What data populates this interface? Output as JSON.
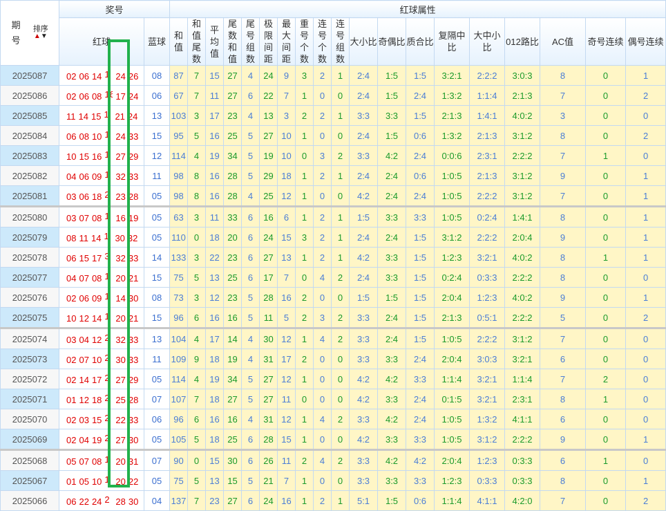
{
  "header": {
    "period": "期号",
    "sort": "排序",
    "sort_up": "▲",
    "sort_down": "▼",
    "prize": "奖号",
    "red_attrs": "红球属性",
    "red_ball": "红球",
    "blue_ball": "蓝球",
    "attr_columns": [
      "和值",
      "和值尾数",
      "平均值",
      "尾数和值",
      "尾号组数",
      "极限间距",
      "最大间距",
      "重号个数",
      "连号个数",
      "连号组数",
      "大小比",
      "奇偶比",
      "质合比",
      "复隔中比",
      "大中小比",
      "012路比",
      "AC值",
      "奇号连续",
      "偶号连续"
    ]
  },
  "colors": {
    "red": "#e00000",
    "blue": "#3b6fd0",
    "green": "#1a9a2a",
    "highlight_box": "#22b14c",
    "attr_bg": "#fff6c6"
  },
  "rows": [
    {
      "period": "2025087",
      "red": [
        "02",
        "06",
        "14",
        "1",
        "24",
        "26"
      ],
      "blue": "08",
      "attrs": [
        "87",
        "7",
        "15",
        "27",
        "4",
        "24",
        "9",
        "3",
        "2",
        "1",
        "2:4",
        "1:5",
        "1:5",
        "3:2:1",
        "2:2:2",
        "3:0:3",
        "8",
        "0",
        "1"
      ]
    },
    {
      "period": "2025086",
      "red": [
        "02",
        "06",
        "08",
        "16",
        "17",
        "24"
      ],
      "blue": "06",
      "attrs": [
        "67",
        "7",
        "11",
        "27",
        "6",
        "22",
        "7",
        "1",
        "0",
        "0",
        "2:4",
        "1:5",
        "2:4",
        "1:3:2",
        "1:1:4",
        "2:1:3",
        "7",
        "0",
        "2"
      ]
    },
    {
      "period": "2025085",
      "red": [
        "11",
        "14",
        "15",
        "1",
        "21",
        "24"
      ],
      "blue": "13",
      "attrs": [
        "103",
        "3",
        "17",
        "23",
        "4",
        "13",
        "3",
        "2",
        "2",
        "1",
        "3:3",
        "3:3",
        "1:5",
        "2:1:3",
        "1:4:1",
        "4:0:2",
        "3",
        "0",
        "0"
      ]
    },
    {
      "period": "2025084",
      "red": [
        "06",
        "08",
        "10",
        "1",
        "24",
        "33"
      ],
      "blue": "15",
      "attrs": [
        "95",
        "5",
        "16",
        "25",
        "5",
        "27",
        "10",
        "1",
        "0",
        "0",
        "2:4",
        "1:5",
        "0:6",
        "1:3:2",
        "2:1:3",
        "3:1:2",
        "8",
        "0",
        "2"
      ]
    },
    {
      "period": "2025083",
      "red": [
        "10",
        "15",
        "16",
        "1",
        "27",
        "29"
      ],
      "blue": "12",
      "attrs": [
        "114",
        "4",
        "19",
        "34",
        "5",
        "19",
        "10",
        "0",
        "3",
        "2",
        "3:3",
        "4:2",
        "2:4",
        "0:0:6",
        "2:3:1",
        "2:2:2",
        "7",
        "1",
        "0"
      ]
    },
    {
      "period": "2025082",
      "red": [
        "04",
        "06",
        "09",
        "1",
        "32",
        "33"
      ],
      "blue": "11",
      "attrs": [
        "98",
        "8",
        "16",
        "28",
        "5",
        "29",
        "18",
        "1",
        "2",
        "1",
        "2:4",
        "2:4",
        "0:6",
        "1:0:5",
        "2:1:3",
        "3:1:2",
        "9",
        "0",
        "1"
      ]
    },
    {
      "period": "2025081",
      "red": [
        "03",
        "06",
        "18",
        "2",
        "23",
        "28"
      ],
      "blue": "05",
      "attrs": [
        "98",
        "8",
        "16",
        "28",
        "4",
        "25",
        "12",
        "1",
        "0",
        "0",
        "4:2",
        "2:4",
        "2:4",
        "1:0:5",
        "2:2:2",
        "3:1:2",
        "7",
        "0",
        "1"
      ]
    },
    {
      "period": "2025080",
      "red": [
        "03",
        "07",
        "08",
        "1",
        "16",
        "19"
      ],
      "blue": "05",
      "attrs": [
        "63",
        "3",
        "11",
        "33",
        "6",
        "16",
        "6",
        "1",
        "2",
        "1",
        "1:5",
        "3:3",
        "3:3",
        "1:0:5",
        "0:2:4",
        "1:4:1",
        "8",
        "0",
        "1"
      ]
    },
    {
      "period": "2025079",
      "red": [
        "08",
        "11",
        "14",
        "1",
        "30",
        "32"
      ],
      "blue": "05",
      "attrs": [
        "110",
        "0",
        "18",
        "20",
        "6",
        "24",
        "15",
        "3",
        "2",
        "1",
        "2:4",
        "2:4",
        "1:5",
        "3:1:2",
        "2:2:2",
        "2:0:4",
        "9",
        "0",
        "1"
      ]
    },
    {
      "period": "2025078",
      "red": [
        "06",
        "15",
        "17",
        "3",
        "32",
        "33"
      ],
      "blue": "14",
      "attrs": [
        "133",
        "3",
        "22",
        "23",
        "6",
        "27",
        "13",
        "1",
        "2",
        "1",
        "4:2",
        "3:3",
        "1:5",
        "1:2:3",
        "3:2:1",
        "4:0:2",
        "8",
        "1",
        "1"
      ]
    },
    {
      "period": "2025077",
      "red": [
        "04",
        "07",
        "08",
        "1",
        "20",
        "21"
      ],
      "blue": "15",
      "attrs": [
        "75",
        "5",
        "13",
        "25",
        "6",
        "17",
        "7",
        "0",
        "4",
        "2",
        "2:4",
        "3:3",
        "1:5",
        "0:2:4",
        "0:3:3",
        "2:2:2",
        "8",
        "0",
        "0"
      ]
    },
    {
      "period": "2025076",
      "red": [
        "02",
        "06",
        "09",
        "1",
        "14",
        "30"
      ],
      "blue": "08",
      "attrs": [
        "73",
        "3",
        "12",
        "23",
        "5",
        "28",
        "16",
        "2",
        "0",
        "0",
        "1:5",
        "1:5",
        "1:5",
        "2:0:4",
        "1:2:3",
        "4:0:2",
        "9",
        "0",
        "1"
      ]
    },
    {
      "period": "2025075",
      "red": [
        "10",
        "12",
        "14",
        "1",
        "20",
        "21"
      ],
      "blue": "15",
      "attrs": [
        "96",
        "6",
        "16",
        "16",
        "5",
        "11",
        "5",
        "2",
        "3",
        "2",
        "3:3",
        "2:4",
        "1:5",
        "2:1:3",
        "0:5:1",
        "2:2:2",
        "5",
        "0",
        "2"
      ]
    },
    {
      "period": "2025074",
      "red": [
        "03",
        "04",
        "12",
        "2",
        "32",
        "33"
      ],
      "blue": "13",
      "attrs": [
        "104",
        "4",
        "17",
        "14",
        "4",
        "30",
        "12",
        "1",
        "4",
        "2",
        "3:3",
        "2:4",
        "1:5",
        "1:0:5",
        "2:2:2",
        "3:1:2",
        "7",
        "0",
        "0"
      ]
    },
    {
      "period": "2025073",
      "red": [
        "02",
        "07",
        "10",
        "2",
        "30",
        "33"
      ],
      "blue": "11",
      "attrs": [
        "109",
        "9",
        "18",
        "19",
        "4",
        "31",
        "17",
        "2",
        "0",
        "0",
        "3:3",
        "3:3",
        "2:4",
        "2:0:4",
        "3:0:3",
        "3:2:1",
        "6",
        "0",
        "0"
      ]
    },
    {
      "period": "2025072",
      "red": [
        "02",
        "14",
        "17",
        "2",
        "27",
        "29"
      ],
      "blue": "05",
      "attrs": [
        "114",
        "4",
        "19",
        "34",
        "5",
        "27",
        "12",
        "1",
        "0",
        "0",
        "4:2",
        "4:2",
        "3:3",
        "1:1:4",
        "3:2:1",
        "1:1:4",
        "7",
        "2",
        "0"
      ]
    },
    {
      "period": "2025071",
      "red": [
        "01",
        "12",
        "18",
        "2",
        "25",
        "28"
      ],
      "blue": "07",
      "attrs": [
        "107",
        "7",
        "18",
        "27",
        "5",
        "27",
        "11",
        "0",
        "0",
        "0",
        "4:2",
        "3:3",
        "2:4",
        "0:1:5",
        "3:2:1",
        "2:3:1",
        "8",
        "1",
        "0"
      ]
    },
    {
      "period": "2025070",
      "red": [
        "02",
        "03",
        "15",
        "2",
        "22",
        "33"
      ],
      "blue": "06",
      "attrs": [
        "96",
        "6",
        "16",
        "16",
        "4",
        "31",
        "12",
        "1",
        "4",
        "2",
        "3:3",
        "4:2",
        "2:4",
        "1:0:5",
        "1:3:2",
        "4:1:1",
        "6",
        "0",
        "0"
      ]
    },
    {
      "period": "2025069",
      "red": [
        "02",
        "04",
        "19",
        "2",
        "27",
        "30"
      ],
      "blue": "05",
      "attrs": [
        "105",
        "5",
        "18",
        "25",
        "6",
        "28",
        "15",
        "1",
        "0",
        "0",
        "4:2",
        "3:3",
        "3:3",
        "1:0:5",
        "3:1:2",
        "2:2:2",
        "9",
        "0",
        "1"
      ]
    },
    {
      "period": "2025068",
      "red": [
        "05",
        "07",
        "08",
        "1",
        "20",
        "31"
      ],
      "blue": "07",
      "attrs": [
        "90",
        "0",
        "15",
        "30",
        "6",
        "26",
        "11",
        "2",
        "4",
        "2",
        "3:3",
        "4:2",
        "4:2",
        "2:0:4",
        "1:2:3",
        "0:3:3",
        "6",
        "1",
        "0"
      ]
    },
    {
      "period": "2025067",
      "red": [
        "01",
        "05",
        "10",
        "1",
        "20",
        "22"
      ],
      "blue": "05",
      "attrs": [
        "75",
        "5",
        "13",
        "15",
        "5",
        "21",
        "7",
        "1",
        "0",
        "0",
        "3:3",
        "3:3",
        "3:3",
        "1:2:3",
        "0:3:3",
        "0:3:3",
        "8",
        "0",
        "1"
      ]
    },
    {
      "period": "2025066",
      "red": [
        "06",
        "22",
        "24",
        "2",
        "28",
        "30"
      ],
      "blue": "04",
      "attrs": [
        "137",
        "7",
        "23",
        "27",
        "6",
        "24",
        "16",
        "1",
        "2",
        "1",
        "5:1",
        "1:5",
        "0:6",
        "1:1:4",
        "4:1:1",
        "4:2:0",
        "7",
        "0",
        "2"
      ]
    }
  ]
}
